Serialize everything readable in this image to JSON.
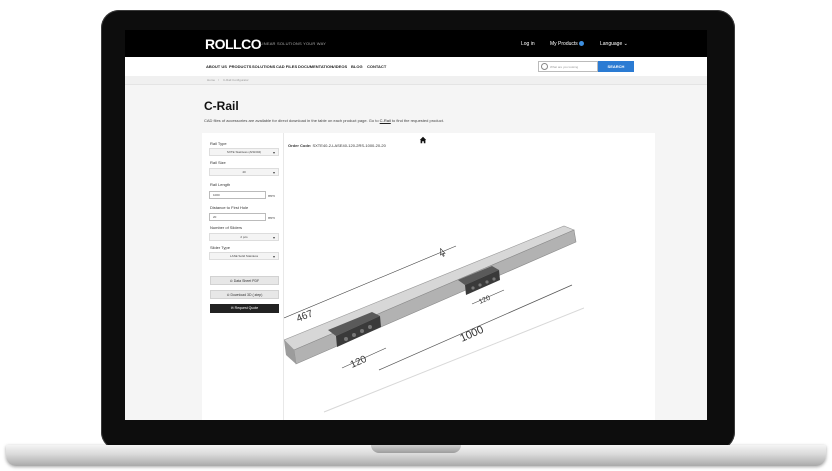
{
  "header": {
    "logo": "ROLLCO",
    "tagline": "LINEAR SOLUTIONS YOUR WAY",
    "login": "Log in",
    "my_products": "My Products",
    "language": "Language ⌄"
  },
  "nav": {
    "items": [
      "ABOUT US",
      "PRODUCTS",
      "SOLUTIONS",
      "CAD FILES",
      "DOCUMENTATION",
      "VIDEOS",
      "BLOG",
      "CONTACT"
    ],
    "search_placeholder": "What are you looking",
    "search_button": "SEARCH"
  },
  "breadcrumb": [
    "Home",
    "/",
    "C-Rail Configurator"
  ],
  "page": {
    "title": "C-Rail",
    "description_prefix": "CAD files of accessories are available for direct download in the table on each product page. Go to ",
    "description_link": "C-Rail",
    "description_suffix": " to find the requested product."
  },
  "config": {
    "rail_type_label": "Rail Type",
    "rail_type_value": "SXTE Stainless (AISI304)",
    "rail_size_label": "Rail Size",
    "rail_size_value": "40",
    "rail_length_label": "Rail Length",
    "rail_length_value": "1000",
    "rail_length_unit": "mm",
    "first_hole_label": "Distance to First Hole",
    "first_hole_value": "20",
    "first_hole_unit": "mm",
    "sliders_label": "Number of Sliders",
    "sliders_value": "2 pcs",
    "slider_type_label": "Slider Type",
    "slider_type_value": "LASE Solid Stainless",
    "datasheet_button": "⊙ Data Sheet PDF",
    "download_button": "⊙ Download 3D (.step)",
    "quote_button": "✉ Request Quote"
  },
  "viewer": {
    "order_code_label": "Order Code:",
    "order_code_value": "SXTE40-2-LASE40-120-2RS-1000-20-20",
    "dim_1000": "1000",
    "dim_120a": "120",
    "dim_120b": "120",
    "dim_467": "467"
  },
  "colors": {
    "header_bg": "#000000",
    "search_button": "#2b7bd3",
    "quote_button": "#222222",
    "rail": "#b7b7b7",
    "slider": "#3a3a3a"
  },
  "icons": [
    "home-icon",
    "search-icon",
    "chevron-down-icon",
    "cursor-icon"
  ]
}
